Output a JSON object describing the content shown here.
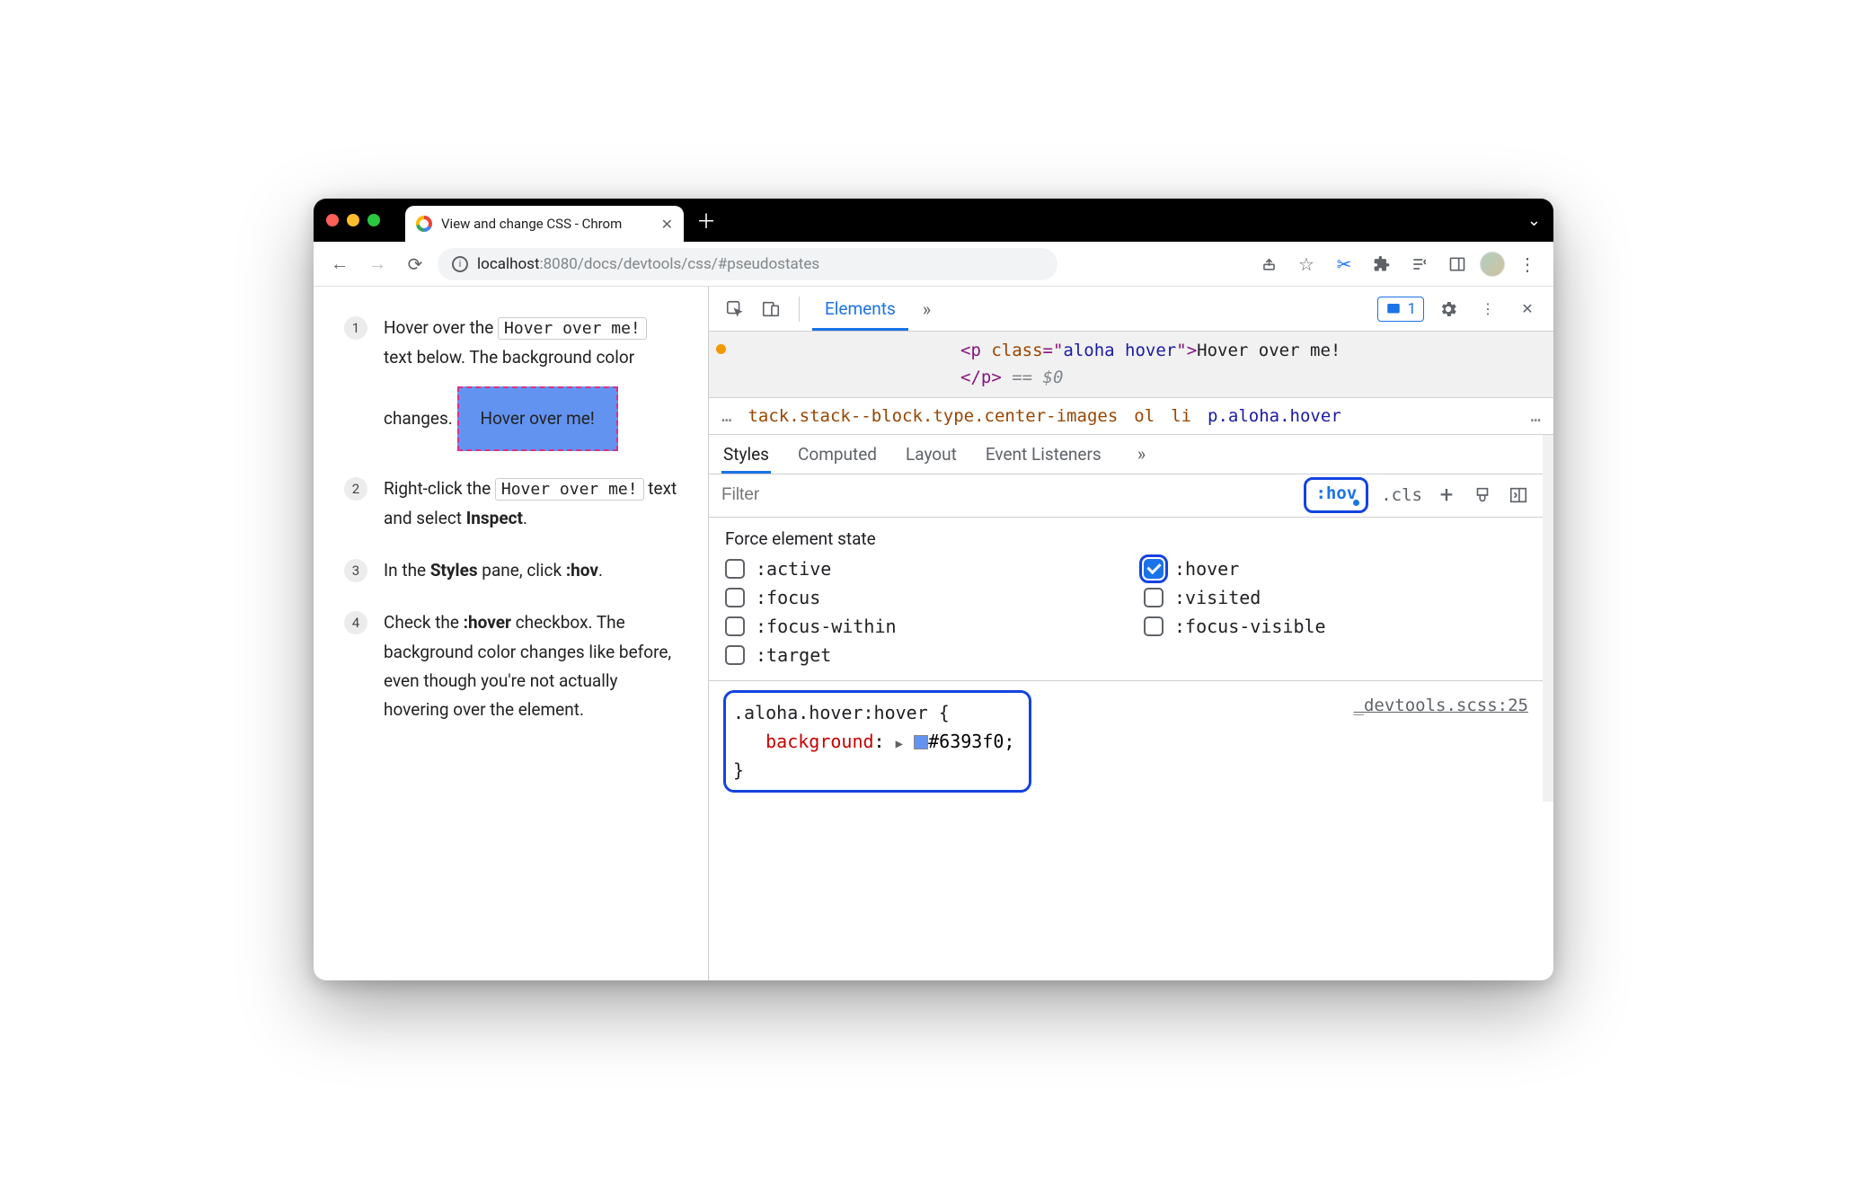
{
  "browser": {
    "tab_title": "View and change CSS - Chrom",
    "url_host": "localhost",
    "url_port_path": ":8080/docs/devtools/css/#pseudostates"
  },
  "page": {
    "steps": [
      {
        "n": "1",
        "pre": "Hover over the ",
        "code": "Hover over me!",
        "post": " text below. The background color changes."
      },
      {
        "n": "2",
        "pre": "Right-click the ",
        "code": "Hover over me!",
        "post": " text and select ",
        "bold": "Inspect",
        "tail": "."
      },
      {
        "n": "3",
        "pre": "In the ",
        "bold": "Styles",
        "mid": " pane, click ",
        "bold2": ":hov",
        "tail": "."
      },
      {
        "n": "4",
        "pre": "Check the ",
        "bold": ":hover",
        "post": " checkbox. The background color changes like before, even though you're not actually hovering over the element."
      }
    ],
    "hover_demo": "Hover over me!"
  },
  "devtools": {
    "panel": "Elements",
    "issues_count": "1",
    "dom": {
      "open_tag_pre": "<p ",
      "attr_name": "class",
      "attr_val": "aloha hover",
      "open_tag_post": ">",
      "text": "Hover over me!",
      "close_tag": "</p>",
      "eq": "== $0"
    },
    "crumbs": {
      "lead": "…",
      "c1": "tack.stack--block.type.center-images",
      "c2": "ol",
      "c3": "li",
      "c4": "p.aloha.hover",
      "tail": "…"
    },
    "style_tabs": [
      "Styles",
      "Computed",
      "Layout",
      "Event Listeners"
    ],
    "filter_placeholder": "Filter",
    "hov_label": ":hov",
    "cls_label": ".cls",
    "force_title": "Force element state",
    "states": [
      {
        "name": ":active",
        "checked": false
      },
      {
        "name": ":hover",
        "checked": true
      },
      {
        "name": ":focus",
        "checked": false
      },
      {
        "name": ":visited",
        "checked": false
      },
      {
        "name": ":focus-within",
        "checked": false
      },
      {
        "name": ":focus-visible",
        "checked": false
      },
      {
        "name": ":target",
        "checked": false
      }
    ],
    "rule": {
      "selector": ".aloha.hover:hover {",
      "prop": "background",
      "value": "#6393f0",
      "close": "}",
      "source": "_devtools.scss:25"
    }
  }
}
